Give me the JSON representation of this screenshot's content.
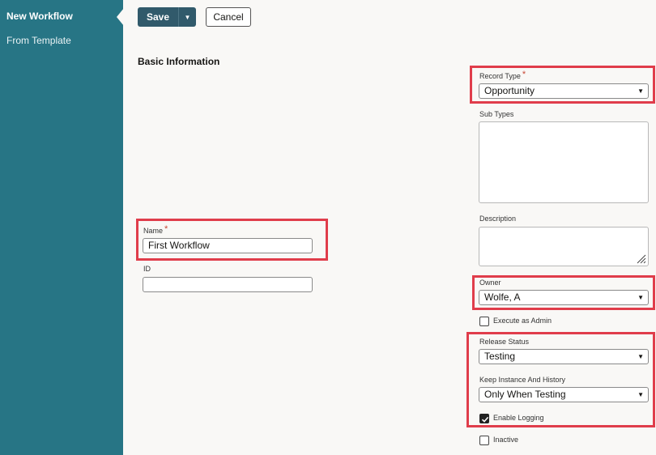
{
  "sidebar": {
    "items": [
      {
        "label": "New Workflow"
      },
      {
        "label": "From Template"
      }
    ]
  },
  "toolbar": {
    "save_label": "Save",
    "cancel_label": "Cancel"
  },
  "section": {
    "title": "Basic Information"
  },
  "form": {
    "name": {
      "label": "Name",
      "required_mark": "*",
      "value": "First Workflow"
    },
    "id": {
      "label": "ID",
      "value": ""
    },
    "record_type": {
      "label": "Record Type",
      "required_mark": "*",
      "value": "Opportunity"
    },
    "sub_types": {
      "label": "Sub Types"
    },
    "description": {
      "label": "Description",
      "value": ""
    },
    "owner": {
      "label": "Owner",
      "value": "Wolfe, A"
    },
    "execute_as_admin": {
      "label": "Execute as Admin",
      "checked": false
    },
    "release_status": {
      "label": "Release Status",
      "value": "Testing"
    },
    "keep_instance": {
      "label": "Keep Instance And History",
      "value": "Only When Testing"
    },
    "enable_logging": {
      "label": "Enable Logging",
      "checked": true
    },
    "inactive": {
      "label": "Inactive",
      "checked": false
    }
  },
  "colors": {
    "sidebar_bg": "#277585",
    "save_button_bg": "#315a6b",
    "highlight": "#e03d4b",
    "required": "#c74634"
  }
}
